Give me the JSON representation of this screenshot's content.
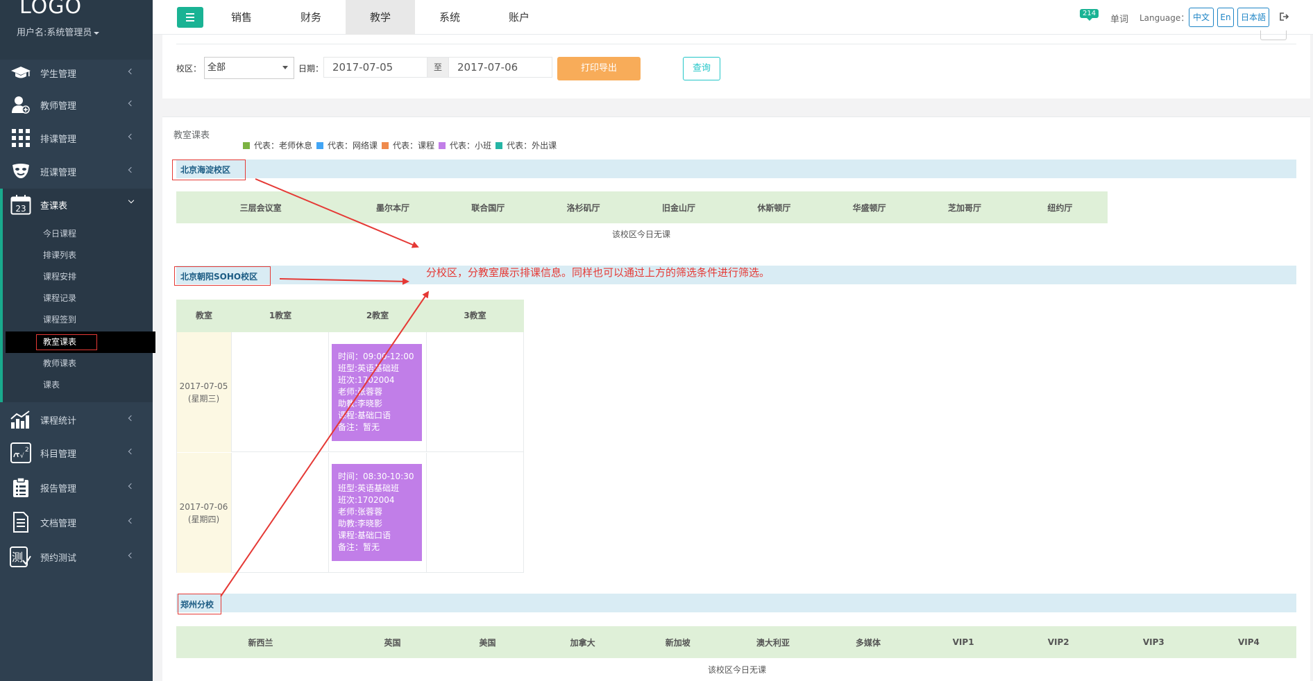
{
  "sidebar": {
    "logo": "LOGO",
    "username": "用户名:系统管理员",
    "items": [
      {
        "label": "学生管理",
        "icon": "graduation-cap-icon"
      },
      {
        "label": "教师管理",
        "icon": "teacher-user-icon"
      },
      {
        "label": "排课管理",
        "icon": "grid-icon"
      },
      {
        "label": "班课管理",
        "icon": "theater-mask-icon"
      },
      {
        "label": "查课表",
        "icon": "calendar-icon",
        "icon_text": "23"
      },
      {
        "label": "课程统计",
        "icon": "bar-chart-icon"
      },
      {
        "label": "科目管理",
        "icon": "formula-icon"
      },
      {
        "label": "报告管理",
        "icon": "clipboard-icon"
      },
      {
        "label": "文档管理",
        "icon": "document-icon"
      },
      {
        "label": "预约测试",
        "icon": "test-icon",
        "icon_text": "测"
      }
    ],
    "submenu": [
      "今日课程",
      "排课列表",
      "课程安排",
      "课程记录",
      "课程签到",
      "教室课表",
      "教师课表",
      "课表"
    ]
  },
  "topbar": {
    "tabs": [
      "销售",
      "财务",
      "教学",
      "系统",
      "账户"
    ],
    "active_tab": "教学",
    "badge": "214",
    "word_label": "单词",
    "language_label": "Language：",
    "languages": [
      "中文",
      "En",
      "日本語"
    ]
  },
  "filter": {
    "campus_label": "校区：",
    "campus_value": "全部",
    "date_label": "日期：",
    "date_from": "2017-07-05",
    "date_sep": "至",
    "date_to": "2017-07-06",
    "print_btn": "打印导出",
    "query_btn": "查询"
  },
  "schedule": {
    "title": "教室课表",
    "legend": [
      {
        "label": "代表：老师休息",
        "color": "#7cb342"
      },
      {
        "label": "代表：网络课",
        "color": "#42a5f5"
      },
      {
        "label": "代表：课程",
        "color": "#ef8a4c"
      },
      {
        "label": "代表：小班",
        "color": "#c17ee8"
      },
      {
        "label": "代表：外出课",
        "color": "#26b5a5"
      }
    ],
    "campuses": [
      {
        "name": "北京海淀校区",
        "rooms": [
          "三层会议室",
          "墨尔本厅",
          "联合国厅",
          "洛杉矶厅",
          "旧金山厅",
          "休斯顿厅",
          "华盛顿厅",
          "芝加哥厅",
          "纽约厅"
        ],
        "empty_text": "该校区今日无课"
      },
      {
        "name": "北京朝阳SOHO校区",
        "header_first": "教室",
        "rooms": [
          "1教室",
          "2教室",
          "3教室"
        ],
        "rows": [
          {
            "date": "2017-07-05",
            "weekday": "(星期三)",
            "lesson": [
              "时间：09:00-12:00",
              "班型:英语基础班",
              "班次:1702004",
              "老师:张蓉蓉",
              "助教:李晓影",
              "课程:基础口语",
              "备注：暂无"
            ]
          },
          {
            "date": "2017-07-06",
            "weekday": "(星期四)",
            "lesson": [
              "时间：08:30-10:30",
              "班型:英语基础班",
              "班次:1702004",
              "老师:张蓉蓉",
              "助教:李晓影",
              "课程:基础口语",
              "备注：暂无"
            ]
          }
        ]
      },
      {
        "name": "郑州分校",
        "rooms": [
          "新西兰",
          "英国",
          "美国",
          "加拿大",
          "新加坡",
          "澳大利亚",
          "多媒体",
          "VIP1",
          "VIP2",
          "VIP3",
          "VIP4"
        ],
        "empty_text": "该校区今日无课"
      }
    ]
  },
  "annotation": "分校区，分教室展示排课信息。同样也可以通过上方的筛选条件进行筛选。",
  "colors": {
    "sidebar_bg": "#2f4050",
    "accent": "#1ab394",
    "print_btn": "#f8ac59",
    "query_btn": "#23c6c8",
    "lesson_bg": "#c17ee8",
    "annotation": "#e53935"
  }
}
